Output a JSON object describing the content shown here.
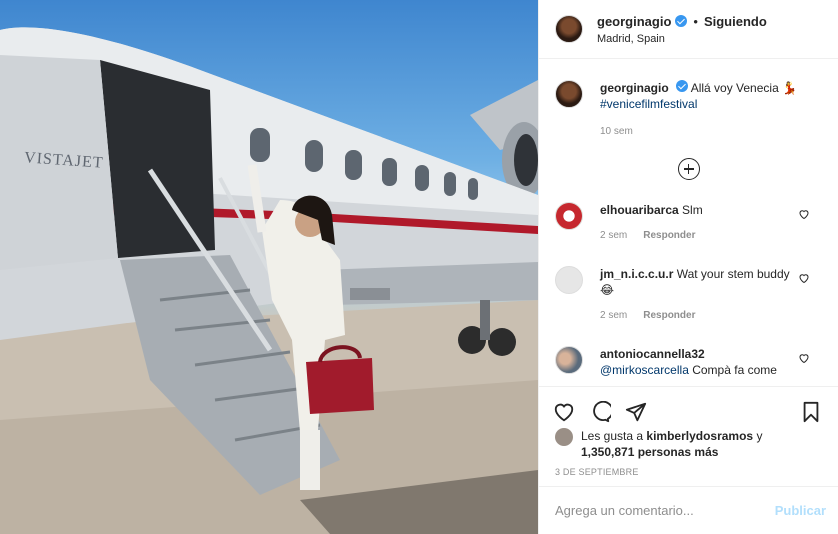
{
  "header": {
    "username": "georginagio",
    "separator": "•",
    "follow_label": "Siguiendo",
    "location": "Madrid, Spain"
  },
  "photo": {
    "livery_text": "VISTAJET"
  },
  "caption": {
    "username": "georginagio",
    "text": "Allá voy Venecia 💃",
    "hashtag": "#venicefilmfestival",
    "time": "10 sem"
  },
  "comments": [
    {
      "username": "elhouaribarca",
      "text": "Slm",
      "time": "2 sem",
      "reply": "Responder"
    },
    {
      "username": "jm_n.i.c.c.u.r",
      "text": "Wat your stem buddy😂",
      "time": "2 sem",
      "reply": "Responder"
    },
    {
      "username": "antoniocannella32",
      "mention": "@mirkoscarcella",
      "text": "Compà fa come"
    }
  ],
  "likes": {
    "prefix": "Les gusta a",
    "user": "kimberlydosramos",
    "connector": "y",
    "count": "1,350,871 personas más"
  },
  "date": "3 DE SEPTIEMBRE",
  "add_comment": {
    "placeholder": "Agrega un comentario...",
    "publish": "Publicar"
  },
  "colors": {
    "verified": "#3897f0",
    "link": "#00376b",
    "publish_disabled": "#b2dffc",
    "livery_stripe": "#b0192a"
  }
}
